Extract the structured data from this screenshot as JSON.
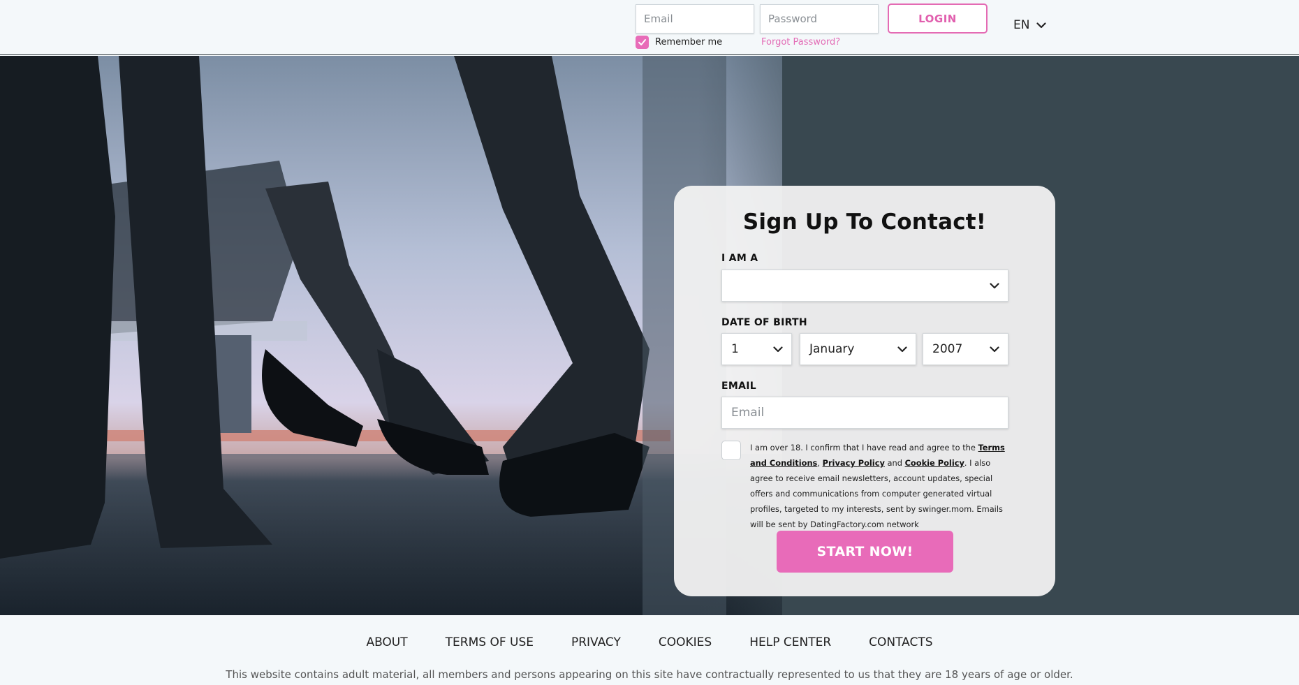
{
  "header": {
    "email_placeholder": "Email",
    "password_placeholder": "Password",
    "login_label": "LOGIN",
    "remember_label": "Remember me",
    "remember_checked": true,
    "forgot_label": "Forgot Password?",
    "language": "EN",
    "accent_color": "#e86cb8"
  },
  "signup": {
    "title": "Sign Up To Contact!",
    "iam_label": "I AM A",
    "iam_value": "",
    "dob_label": "DATE OF BIRTH",
    "dob_day": "1",
    "dob_month": "January",
    "dob_year": "2007",
    "email_label": "EMAIL",
    "email_placeholder": "Email",
    "terms": {
      "prefix": "I am over 18. I confirm that I have read and agree to the ",
      "terms_link": "Terms and Conditions",
      "sep1": ", ",
      "privacy_link": "Privacy Policy",
      "sep2": " and ",
      "cookie_link": "Cookie Policy",
      "suffix": ". I also agree to receive email newsletters, account updates, special offers and communications from computer generated virtual profiles, targeted to my interests, sent by swinger.mom. Emails will be sent by DatingFactory.com network"
    },
    "agree_checked": false,
    "cta_label": "START NOW!"
  },
  "footer": {
    "links": [
      "ABOUT",
      "TERMS OF USE",
      "PRIVACY",
      "COOKIES",
      "HELP CENTER",
      "CONTACTS"
    ],
    "disclaimer": "This website contains adult material, all members and persons appearing on this site have contractually represented to us that they are 18 years of age or older."
  },
  "icons": {
    "chevron": "chevron-down-icon",
    "checkmark": "checkmark-icon"
  }
}
